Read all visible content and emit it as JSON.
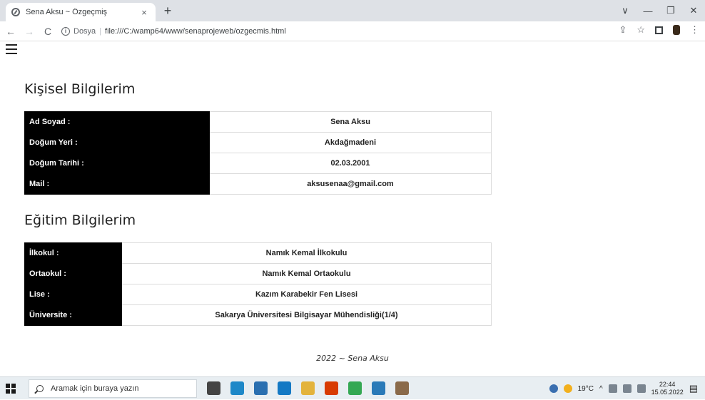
{
  "browser": {
    "tab_title": "Sena Aksu ~ Özgeçmiş",
    "tab_close": "×",
    "new_tab": "+",
    "back": "←",
    "forward": "→",
    "reload": "C",
    "info": "i",
    "url_scheme": "Dosya",
    "url_separator": "|",
    "url": "file:///C:/wamp64/www/senaprojeweb/ozgecmis.html",
    "window_controls": [
      "∨",
      "—",
      "❐",
      "✕"
    ],
    "toolbar_icons": [
      "⇪",
      "☆",
      "⋮"
    ]
  },
  "personal": {
    "title": "Kişisel Bilgilerim",
    "rows": [
      {
        "label": "Ad Soyad :",
        "value": "Sena Aksu"
      },
      {
        "label": "Doğum Yeri :",
        "value": "Akdağmadeni"
      },
      {
        "label": "Doğum Tarihi :",
        "value": "02.03.2001"
      },
      {
        "label": "Mail :",
        "value": "aksusenaa@gmail.com"
      }
    ]
  },
  "education": {
    "title": "Eğitim Bilgilerim",
    "rows": [
      {
        "label": "İlkokul :",
        "value": "Namık Kemal İlkokulu"
      },
      {
        "label": "Ortaokul :",
        "value": "Namık Kemal Ortaokulu"
      },
      {
        "label": "Lise :",
        "value": "Kazım Karabekir Fen Lisesi"
      },
      {
        "label": "Üniversite :",
        "value": "Sakarya Üniversitesi Bilgisayar Mühendisliği(1/4)"
      }
    ]
  },
  "footer": "2022 ~ Sena Aksu",
  "taskbar": {
    "search_placeholder": "Aramak için buraya yazın",
    "temperature": "19°C",
    "time": "22:44",
    "date": "15.05.2022",
    "tray_arrow": "^",
    "notification_icon": "▤",
    "apps": [
      {
        "name": "task-view",
        "color": "#444444"
      },
      {
        "name": "edge",
        "color": "#1e88c8"
      },
      {
        "name": "store",
        "color": "#2a6fb0"
      },
      {
        "name": "mail",
        "color": "#1479c4"
      },
      {
        "name": "explorer",
        "color": "#e3b33c"
      },
      {
        "name": "office",
        "color": "#d83b01"
      },
      {
        "name": "chrome",
        "color": "#34a853"
      },
      {
        "name": "photos",
        "color": "#2a7ab8"
      },
      {
        "name": "app",
        "color": "#8a6a4a"
      }
    ],
    "colors": {
      "accent": "#000000"
    }
  }
}
